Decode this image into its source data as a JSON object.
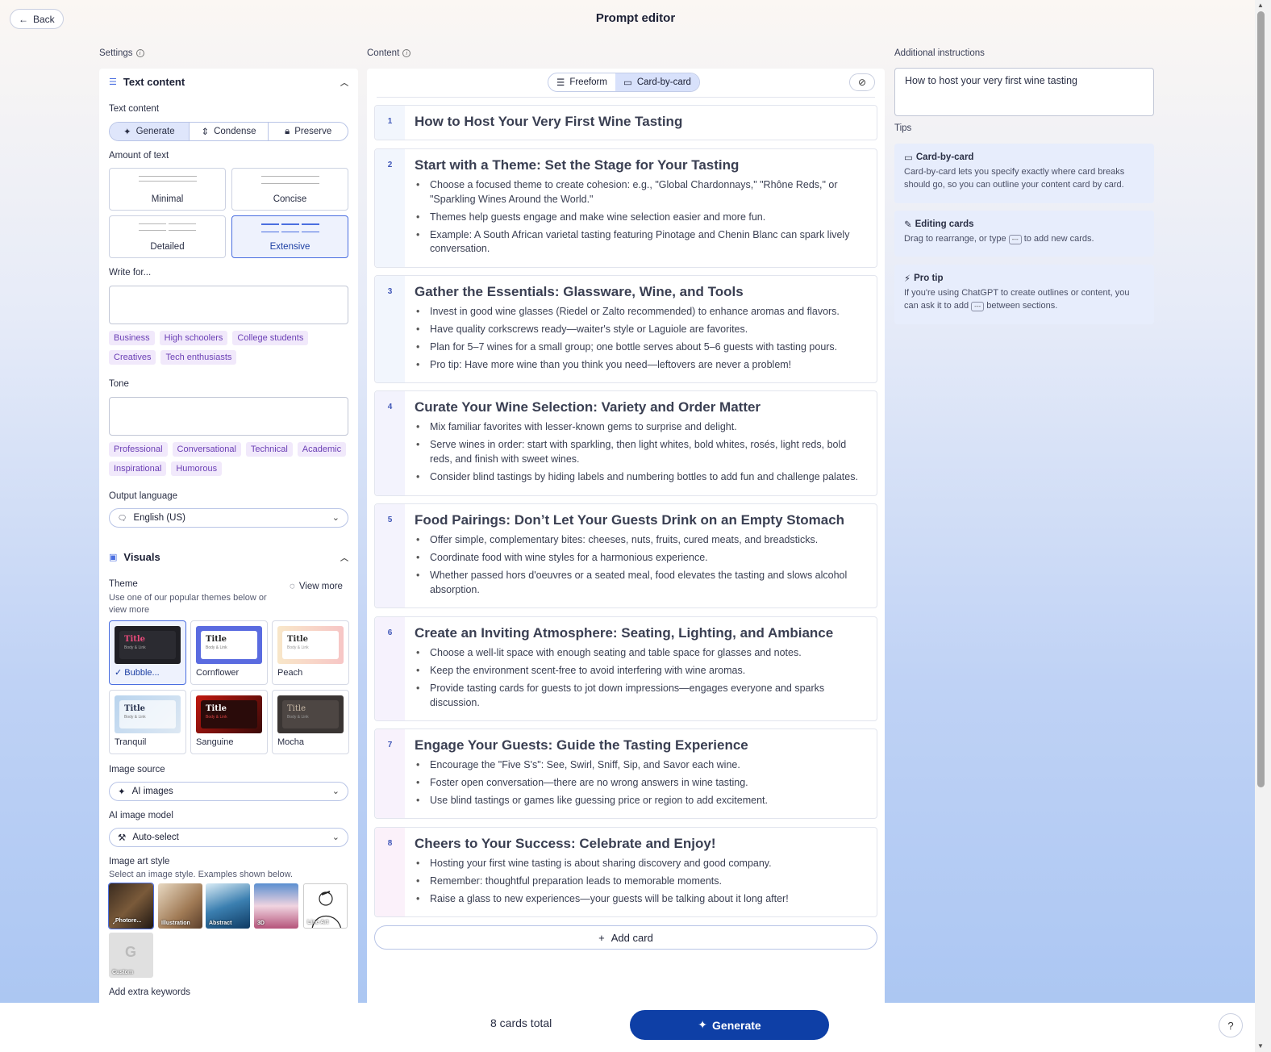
{
  "header": {
    "back_label": "Back",
    "title": "Prompt editor"
  },
  "columns": {
    "settings": "Settings",
    "content": "Content",
    "additional": "Additional instructions"
  },
  "text_content": {
    "section_title": "Text content",
    "mode_label": "Text content",
    "modes": [
      "Generate",
      "Condense",
      "Preserve"
    ],
    "selected_mode": "Generate",
    "amount_label": "Amount of text",
    "amounts": [
      "Minimal",
      "Concise",
      "Detailed",
      "Extensive"
    ],
    "selected_amount": "Extensive",
    "write_for_label": "Write for...",
    "audiences": [
      "Business",
      "High schoolers",
      "College students",
      "Creatives",
      "Tech enthusiasts"
    ],
    "tone_label": "Tone",
    "tones": [
      "Professional",
      "Conversational",
      "Technical",
      "Academic",
      "Inspirational",
      "Humorous"
    ],
    "language_label": "Output language",
    "language_value": "English (US)"
  },
  "visuals": {
    "section_title": "Visuals",
    "theme_label": "Theme",
    "theme_desc": "Use one of our popular themes below or view more",
    "view_more": "View more",
    "theme_preview_title": "Title",
    "theme_preview_body": "Body & Link",
    "themes": [
      "Bubble...",
      "Cornflower",
      "Peach",
      "Tranquil",
      "Sanguine",
      "Mocha"
    ],
    "selected_theme": "Bubble...",
    "image_source_label": "Image source",
    "image_source_value": "AI images",
    "model_label": "AI image model",
    "model_value": "Auto-select",
    "art_style_label": "Image art style",
    "art_style_desc": "Select an image style. Examples shown below.",
    "art_styles": [
      "Photore...",
      "Illustration",
      "Abstract",
      "3D",
      "Line Art",
      "Custom"
    ],
    "selected_art_style": "Photore...",
    "keywords_label": "Add extra keywords"
  },
  "content": {
    "modes": [
      "Freeform",
      "Card-by-card"
    ],
    "selected_mode": "Card-by-card",
    "cards": [
      {
        "num": "1",
        "title": "How to Host Your Very First Wine Tasting",
        "bullets": []
      },
      {
        "num": "2",
        "title": "Start with a Theme: Set the Stage for Your Tasting",
        "bullets": [
          "Choose a focused theme to create cohesion: e.g., \"Global Chardonnays,\" \"Rhône Reds,\" or \"Sparkling Wines Around the World.\"",
          "Themes help guests engage and make wine selection easier and more fun.",
          "Example: A South African varietal tasting featuring Pinotage and Chenin Blanc can spark lively conversation."
        ]
      },
      {
        "num": "3",
        "title": "Gather the Essentials: Glassware, Wine, and Tools",
        "bullets": [
          "Invest in good wine glasses (Riedel or Zalto recommended) to enhance aromas and flavors.",
          "Have quality corkscrews ready—waiter's style or Laguiole are favorites.",
          "Plan for 5–7 wines for a small group; one bottle serves about 5–6 guests with tasting pours.",
          "Pro tip: Have more wine than you think you need—leftovers are never a problem!"
        ]
      },
      {
        "num": "4",
        "title": "Curate Your Wine Selection: Variety and Order Matter",
        "bullets": [
          "Mix familiar favorites with lesser-known gems to surprise and delight.",
          "Serve wines in order: start with sparkling, then light whites, bold whites, rosés, light reds, bold reds, and finish with sweet wines.",
          "Consider blind tastings by hiding labels and numbering bottles to add fun and challenge palates."
        ]
      },
      {
        "num": "5",
        "title": "Food Pairings: Don’t Let Your Guests Drink on an Empty Stomach",
        "bullets": [
          "Offer simple, complementary bites: cheeses, nuts, fruits, cured meats, and breadsticks.",
          "Coordinate food with wine styles for a harmonious experience.",
          "Whether passed hors d'oeuvres or a seated meal, food elevates the tasting and slows alcohol absorption."
        ]
      },
      {
        "num": "6",
        "title": "Create an Inviting Atmosphere: Seating, Lighting, and Ambiance",
        "bullets": [
          "Choose a well-lit space with enough seating and table space for glasses and notes.",
          "Keep the environment scent-free to avoid interfering with wine aromas.",
          "Provide tasting cards for guests to jot down impressions—engages everyone and sparks discussion."
        ]
      },
      {
        "num": "7",
        "title": "Engage Your Guests: Guide the Tasting Experience",
        "bullets": [
          "Encourage the \"Five S's\": See, Swirl, Sniff, Sip, and Savor each wine.",
          "Foster open conversation—there are no wrong answers in wine tasting.",
          "Use blind tastings or games like guessing price or region to add excitement."
        ]
      },
      {
        "num": "8",
        "title": "Cheers to Your Success: Celebrate and Enjoy!",
        "bullets": [
          "Hosting your first wine tasting is about sharing discovery and good company.",
          "Remember: thoughtful preparation leads to memorable moments.",
          "Raise a glass to new experiences—your guests will be talking about it long after!"
        ]
      }
    ],
    "add_card_label": "Add card"
  },
  "additional": {
    "value": "How to host your very first wine tasting",
    "tips_label": "Tips",
    "tips": [
      {
        "title": "Card-by-card",
        "text": "Card-by-card lets you specify exactly where card breaks should go, so you can outline your content card by card."
      },
      {
        "title": "Editing cards",
        "text_before": "Drag to rearrange, or type",
        "kbd": "---",
        "text_after": "to add new cards."
      },
      {
        "title": "Pro tip",
        "text_before": "If you're using ChatGPT to create outlines or content, you can ask it to add",
        "kbd": "---",
        "text_after": "between sections."
      }
    ]
  },
  "footer": {
    "total": "8 cards total",
    "generate_label": "Generate",
    "help_label": "?"
  },
  "colors": {
    "accent": "#0e3fa6",
    "chip_bg": "#f1e9fb",
    "chip_text": "#6b3fb5",
    "tip_bg": "#e7edfc"
  }
}
